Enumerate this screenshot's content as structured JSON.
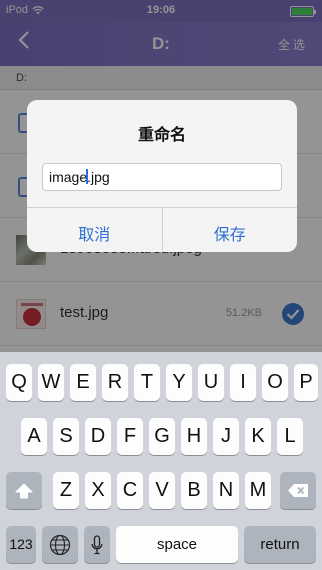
{
  "status_bar": {
    "carrier": "iPod",
    "time": "19:06"
  },
  "nav": {
    "title": "D:",
    "select_all": "全选"
  },
  "path": "D:",
  "files": [
    {
      "name": "",
      "size": "",
      "kind": "folder"
    },
    {
      "name": "",
      "size": "",
      "kind": "folder"
    },
    {
      "name": "15908083...ared.jpeg",
      "size": "",
      "kind": "image"
    },
    {
      "name": "test.jpg",
      "size": "51.2KB",
      "kind": "image",
      "selected": true
    }
  ],
  "dialog": {
    "title": "重命名",
    "input_before_caret": "image",
    "input_after_caret": ".jpg",
    "cancel": "取消",
    "save": "保存"
  },
  "keyboard": {
    "row1": [
      "Q",
      "W",
      "E",
      "R",
      "T",
      "Y",
      "U",
      "I",
      "O",
      "P"
    ],
    "row2": [
      "A",
      "S",
      "D",
      "F",
      "G",
      "H",
      "J",
      "K",
      "L"
    ],
    "row3": [
      "Z",
      "X",
      "C",
      "V",
      "B",
      "N",
      "M"
    ],
    "numbers": "123",
    "space": "space",
    "return": "return"
  }
}
